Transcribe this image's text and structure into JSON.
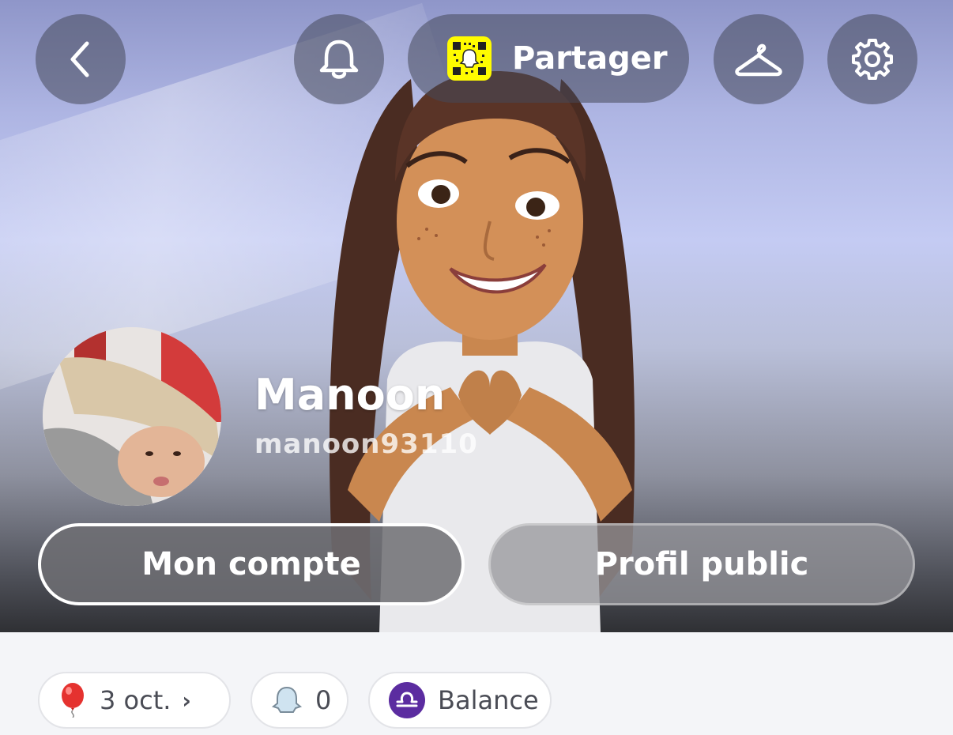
{
  "header": {
    "share_label": "Partager"
  },
  "profile": {
    "display_name": "Manoon",
    "username": "manoon93110"
  },
  "actions": {
    "account_label": "Mon compte",
    "public_profile_label": "Profil public"
  },
  "chips": [
    {
      "icon": "balloon-icon",
      "label": "3 oct."
    },
    {
      "icon": "ghost-icon",
      "label": "0"
    },
    {
      "icon": "libra-zodiac-icon",
      "label": "Balance"
    }
  ],
  "colors": {
    "snapcode_yellow": "#fffc00",
    "zodiac_purple": "#5b2ca0"
  }
}
